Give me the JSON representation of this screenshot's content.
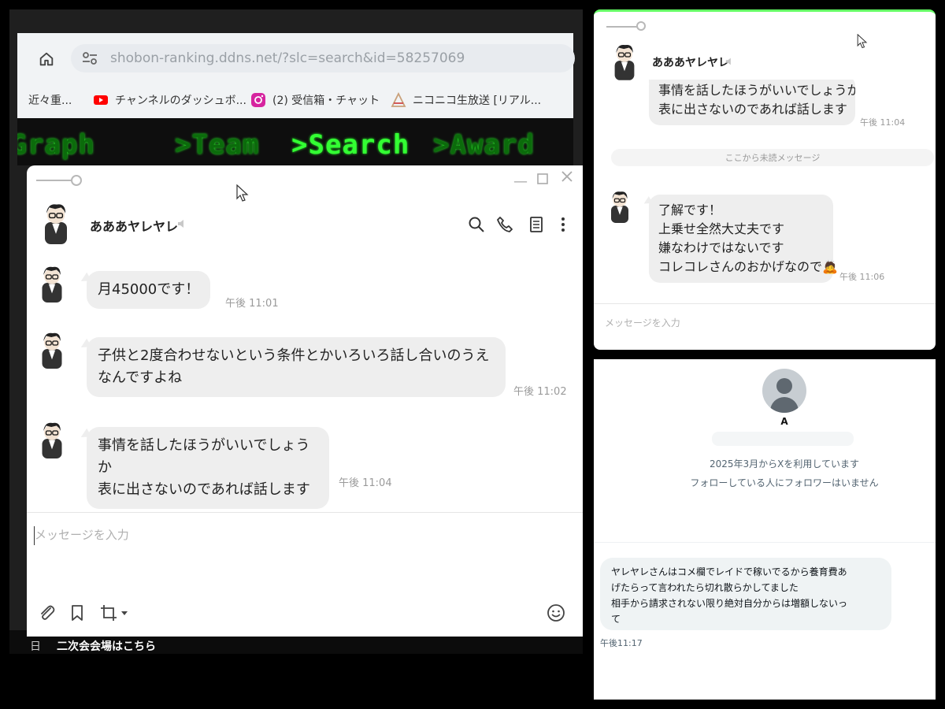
{
  "browser": {
    "url": "shobon-ranking.ddns.net/?slc=search&id=58257069",
    "bookmarks": [
      {
        "icon": "bookmark-icon",
        "label": "近々重..."
      },
      {
        "icon": "youtube-icon",
        "label": "チャンネルのダッシュボ..."
      },
      {
        "icon": "instagram-icon",
        "label": "(2) 受信箱・チャット"
      },
      {
        "icon": "niconico-icon",
        "label": "ニコニコ生放送 [リアル..."
      }
    ],
    "site_nav": [
      ">Graph",
      ">Team",
      ">Search",
      ">Award"
    ],
    "active_nav": ">Search",
    "bottom_link": "二次会会場はこちら",
    "bottom_date": "日"
  },
  "chat_main": {
    "contact_name": "あああヤレヤレ",
    "header_icons": [
      "search-icon",
      "phone-icon",
      "note-icon",
      "more-icon"
    ],
    "messages": [
      {
        "text": "月45000です！",
        "time": "午後 11:01"
      },
      {
        "text": "子供と2度合わせないという条件とかいろいろ話し合いのうえなんですよね",
        "time": "午後 11:02"
      },
      {
        "text": "事情を話したほうがいいでしょうか\n表に出さないのであれば話します",
        "time": "午後 11:04"
      }
    ],
    "input_placeholder": "メッセージを入力",
    "bottom_tools": [
      "attach-icon",
      "bookmark-icon",
      "crop-icon",
      "emoji-icon"
    ]
  },
  "chat_right": {
    "contact_name": "あああヤレヤレ",
    "prev_message_partial": "事情を話したほうがいいでしょうか",
    "prev_message": "表に出さないのであれば話します",
    "prev_time": "午後 11:04",
    "unread_divider": "ここから未読メッセージ",
    "messages": [
      {
        "lines": [
          "了解です！",
          "上乗せ全然大丈夫です",
          "嫌なわけではないです",
          "コレコレさんのおかげなので"
        ],
        "emoji": "🙇",
        "time": "午後 11:06"
      }
    ],
    "input_placeholder": "メッセージを入力"
  },
  "x_dm": {
    "user_name": "A",
    "joined": "2025年3月からXを利用しています",
    "followers_note": "フォローしている人にフォロワーはいません",
    "message_lines": [
      "ヤレヤレさんはコメ欄でレイドで稼いでるから養育費あ",
      "げたらって言われたら切れ散らかしてました",
      "相手から請求されない限り絶対自分からは増額しないっ",
      "て"
    ],
    "message_time": "午後11:17"
  },
  "colors": {
    "bubble_gray": "#eeeeee",
    "nav_green": "#33ff33",
    "x_bubble": "#eff3f4"
  }
}
